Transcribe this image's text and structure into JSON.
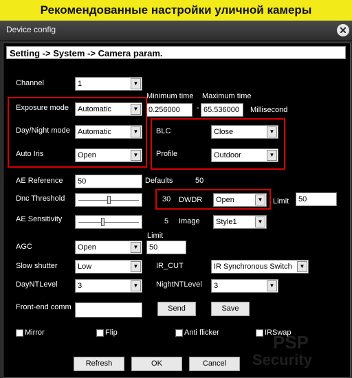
{
  "banner": {
    "text": "Рекомендованные настройки уличной камеры"
  },
  "window": {
    "title": "Device config"
  },
  "path": "Setting -> System -> Camera param.",
  "channel": {
    "label": "Channel",
    "value": "1"
  },
  "time": {
    "min_label": "Minimum time",
    "max_label": "Maximum time",
    "min_value": "0.256000",
    "max_value": "65.536000",
    "unit": "Millisecond",
    "sep": "-"
  },
  "exposure": {
    "label": "Exposure mode",
    "value": "Automatic"
  },
  "daynight": {
    "label": "Day/Night mode",
    "value": "Automatic"
  },
  "autoiris": {
    "label": "Auto Iris",
    "value": "Open"
  },
  "blc": {
    "label": "BLC",
    "value": "Close"
  },
  "profile": {
    "label": "Profile",
    "value": "Outdoor"
  },
  "ae_reference": {
    "label": "AE Reference",
    "value": "50",
    "defaults_label": "Defaults",
    "defaults_value": "50"
  },
  "dnc_threshold": {
    "label": "Dnc Threshold",
    "value": "30",
    "slider_level": 0.5
  },
  "dwdr": {
    "label": "DWDR",
    "value": "Open",
    "limit_label": "Limit",
    "limit_value": "50"
  },
  "ae_sensitivity": {
    "label": "AE Sensitivity",
    "value": "5",
    "slider_level": 0.4
  },
  "image": {
    "label": "Image",
    "value": "Style1"
  },
  "agc": {
    "label": "AGC",
    "value": "Open",
    "limit_label": "Limit",
    "limit_value": "50"
  },
  "slow_shutter": {
    "label": "Slow shutter",
    "value": "Low"
  },
  "ir_cut": {
    "label": "IR_CUT",
    "value": "IR Synchronous Switch"
  },
  "day_nt": {
    "label": "DayNTLevel",
    "value": "3"
  },
  "night_nt": {
    "label": "NightNTLevel",
    "value": "3"
  },
  "frontend": {
    "label": "Front-end comm",
    "value": ""
  },
  "buttons": {
    "send": "Send",
    "save": "Save",
    "refresh": "Refresh",
    "ok": "OK",
    "cancel": "Cancel"
  },
  "checks": {
    "mirror": "Mirror",
    "flip": "Flip",
    "antiflicker": "Anti flicker",
    "irswap": "IRSwap"
  },
  "watermark": {
    "line1": "PSP",
    "line2": "Security"
  },
  "colors": {
    "highlight": "#d90000",
    "banner": "#f2ea19"
  }
}
